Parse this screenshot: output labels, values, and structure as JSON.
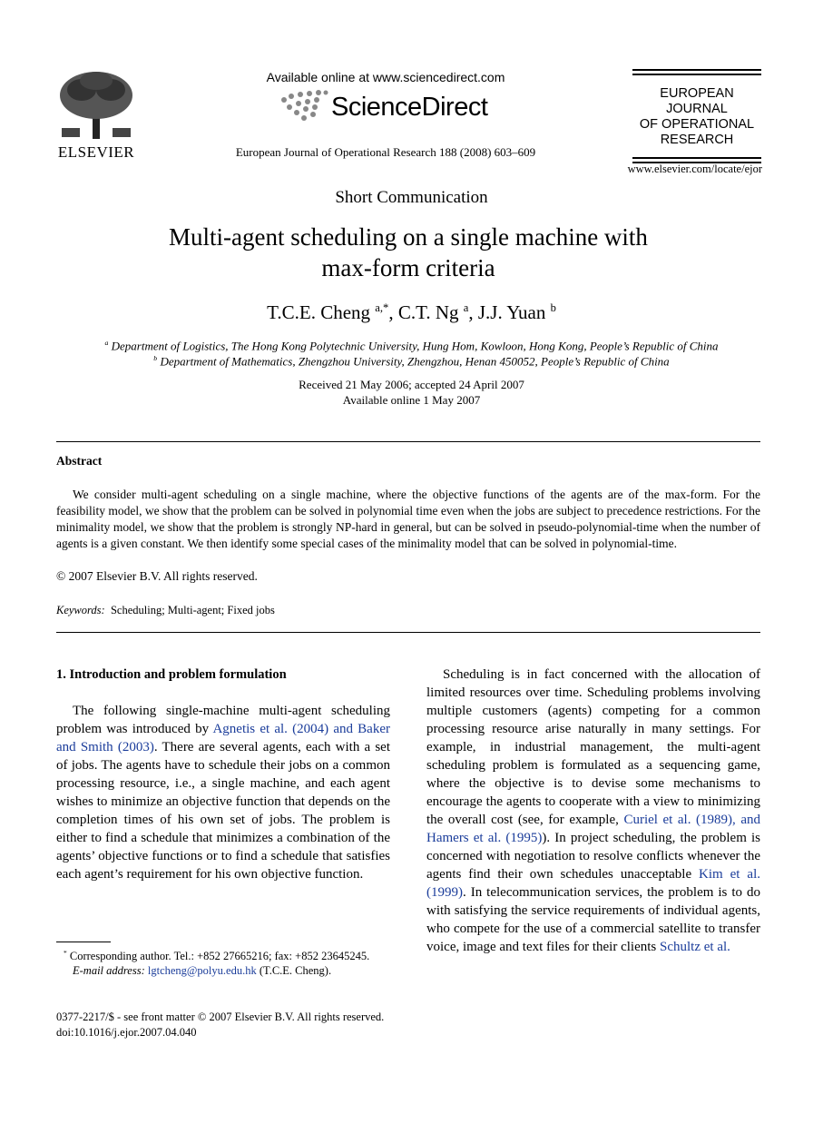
{
  "header": {
    "publisher": "ELSEVIER",
    "available_online": "Available online at www.sciencedirect.com",
    "sciencedirect": "ScienceDirect",
    "journal_citation": "European Journal of Operational Research 188 (2008) 603–609",
    "journal_logo_lines": [
      "EUROPEAN",
      "JOURNAL",
      "OF OPERATIONAL",
      "RESEARCH"
    ],
    "journal_url": "www.elsevier.com/locate/ejor"
  },
  "article": {
    "type": "Short Communication",
    "title_line1": "Multi-agent scheduling on a single machine with",
    "title_line2": "max-form criteria",
    "authors": [
      {
        "name": "T.C.E. Cheng",
        "sup": "a,*"
      },
      {
        "name": "C.T. Ng",
        "sup": "a"
      },
      {
        "name": "J.J. Yuan",
        "sup": "b"
      }
    ],
    "affiliations": [
      {
        "mark": "a",
        "text": "Department of Logistics, The Hong Kong Polytechnic University, Hung Hom, Kowloon, Hong Kong, People’s Republic of China"
      },
      {
        "mark": "b",
        "text": "Department of Mathematics, Zhengzhou University, Zhengzhou, Henan 450052, People’s Republic of China"
      }
    ],
    "received": "Received 21 May 2006; accepted 24 April 2007",
    "available": "Available online 1 May 2007"
  },
  "abstract": {
    "heading": "Abstract",
    "body": "We consider multi-agent scheduling on a single machine, where the objective functions of the agents are of the max-form. For the feasibility model, we show that the problem can be solved in polynomial time even when the jobs are subject to precedence restrictions. For the minimality model, we show that the problem is strongly NP-hard in general, but can be solved in pseudo-polynomial-time when the number of agents is a given constant. We then identify some special cases of the minimality model that can be solved in polynomial-time.",
    "copyright": "© 2007 Elsevier B.V. All rights reserved.",
    "keywords_label": "Keywords:",
    "keywords": "Scheduling; Multi-agent; Fixed jobs"
  },
  "body": {
    "section1_heading": "1. Introduction and problem formulation",
    "left_p1_a": "The following single-machine multi-agent scheduling problem was introduced by ",
    "left_p1_link": "Agnetis et al. (2004) and Baker and Smith (2003)",
    "left_p1_b": ". There are several agents, each with a set of jobs. The agents have to schedule their jobs on a common processing resource, i.e., a single machine, and each agent wishes to minimize an objective function that depends on the completion times of his own set of jobs. The problem is either to find a schedule that minimizes a combination of the agents’ objective functions or to find a schedule that satisfies each agent’s requirement for his own objective function.",
    "right_a": "Scheduling is in fact concerned with the allocation of limited resources over time. Scheduling problems involving multiple customers (agents) competing for a common processing resource arise naturally in many settings. For example, in industrial management, the multi-agent scheduling problem is formulated as a sequencing game, where the objective is to devise some mechanisms to encourage the agents to cooperate with a view to minimizing the overall cost (see, for example, ",
    "right_link1": "Curiel et al. (1989), and Hamers et al. (1995)",
    "right_b": "). In project scheduling, the problem is concerned with negotiation to resolve conflicts whenever the agents find their own schedules unacceptable ",
    "right_link2": "Kim et al. (1999)",
    "right_c": ". In telecommunication services, the problem is to do with satisfying the service requirements of individual agents, who compete for the use of a commercial satellite to transfer voice, image and text files for their clients ",
    "right_link3": "Schultz et al."
  },
  "footnote": {
    "mark": "*",
    "text": "Corresponding author. Tel.: +852 27665216; fax: +852 23645245.",
    "email_label": "E-mail address:",
    "email": "lgtcheng@polyu.edu.hk",
    "email_suffix": " (T.C.E. Cheng)."
  },
  "bottom": {
    "line1": "0377-2217/$ - see front matter © 2007 Elsevier B.V. All rights reserved.",
    "line2": "doi:10.1016/j.ejor.2007.04.040"
  },
  "colors": {
    "link": "#1a3c9a"
  }
}
